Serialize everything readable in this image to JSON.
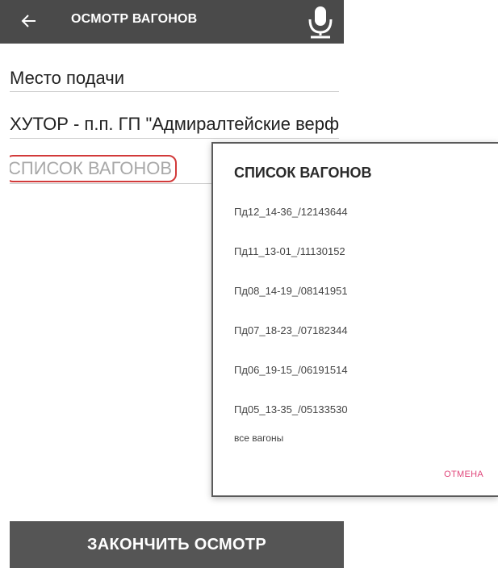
{
  "appbar": {
    "title": "ОСМОТР ВАГОНОВ",
    "back_icon": "arrow-left-icon",
    "mic_icon": "microphone-icon",
    "background_color": "#4a4a4a"
  },
  "form": {
    "label_text": "Место подачи",
    "location_value": "ХУТОР - п.п. ГП \"Адмиралтейские верф",
    "wagons_placeholder": "СПИСОК ВАГОНОВ",
    "highlight_color": "#d23a3a"
  },
  "dialog": {
    "title": "СПИСОК ВАГОНОВ",
    "items": [
      "Пд12_14-36_/12143644",
      "Пд11_13-01_/11130152",
      "Пд08_14-19_/08141951",
      "Пд07_18-23_/07182344",
      "Пд06_19-15_/06191514",
      "Пд05_13-35_/05133530"
    ],
    "all_option": "все вагоны",
    "cancel_label": "ОТМЕНА",
    "cancel_color": "#e0457a"
  },
  "footer": {
    "finish_label": "ЗАКОНЧИТЬ ОСМОТР",
    "button_color": "#555555"
  }
}
